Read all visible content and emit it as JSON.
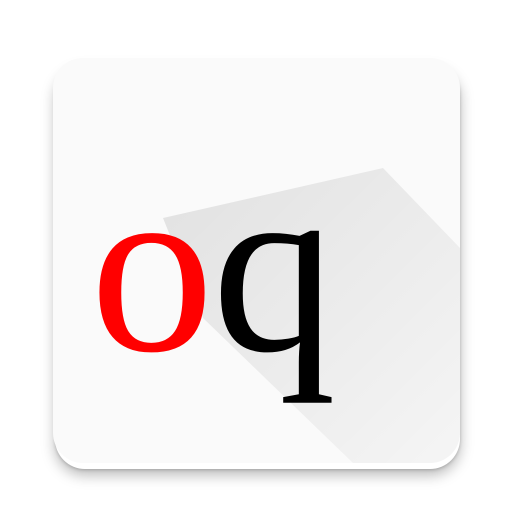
{
  "icon": {
    "letters": [
      "o",
      "q"
    ],
    "colors": {
      "first_letter": "#ff0000",
      "second_letter": "#000000",
      "tile_background": "#fafafa",
      "long_shadow": "#000000"
    }
  }
}
